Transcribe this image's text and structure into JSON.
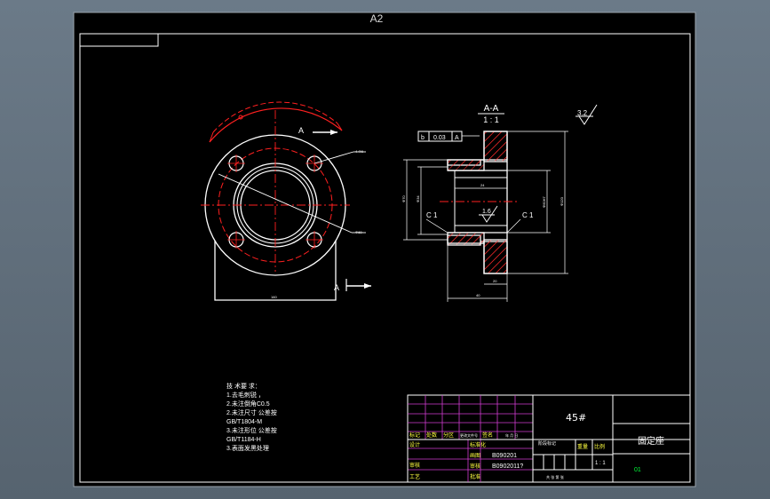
{
  "sheet": {
    "size_label": "A2"
  },
  "view_section": {
    "label": "A-A",
    "scale": "1 : 1",
    "roughness_symbol": "3.2"
  },
  "view_front": {
    "cut_label_top": "A",
    "cut_label_bottom": "A"
  },
  "tolerance_frame": {
    "datum_ref": "b",
    "value": "0.03",
    "datum": "A"
  },
  "dimensions": {
    "chamfer_left": "C 1",
    "chamfer_right": "C 1",
    "roughness_bore": "1.6"
  },
  "tech_notes": {
    "title": "技 术要 求：",
    "lines": [
      "1.去毛刺锐 ，",
      "2.未注倒角C0.5",
      "2.未注尺寸 公差按",
      "GB/T1804-M",
      "3.未注形位 公差按",
      "GB/T1184-H",
      "3.表面发黑处理"
    ]
  },
  "title_block": {
    "material": "45#",
    "part_name": "固定座",
    "drawing_no": "01",
    "scale_value": "1 : 1",
    "sheet_info": "共 张 第 张",
    "headers": [
      "标记",
      "处数",
      "分区",
      "更改文件号",
      "签名",
      "年 月 日"
    ],
    "row_design": "设计",
    "row_standard": "标准化",
    "row_stage": "阶段标记",
    "row_weight": "重量",
    "row_ratio": "比例",
    "row_check": "审核",
    "row_process": "工艺",
    "row_approve": "批准",
    "label_draw": "画图",
    "value_draw": "B090201",
    "label_proof": "审核",
    "value_proof": "B0902011?"
  }
}
